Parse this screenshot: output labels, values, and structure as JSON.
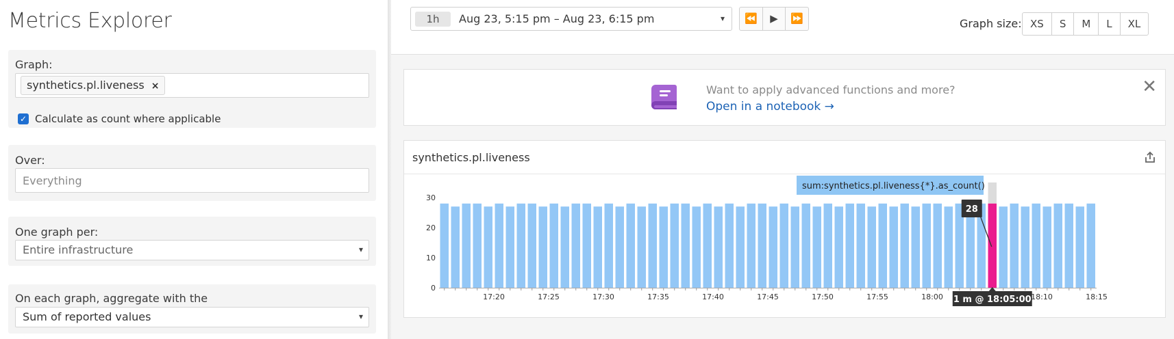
{
  "left": {
    "title": "Metrics Explorer",
    "graph": {
      "label": "Graph:",
      "metric": "synthetics.pl.liveness",
      "remove": "×",
      "checkbox_label": "Calculate as count where applicable",
      "checked": true
    },
    "over": {
      "label": "Over:",
      "placeholder": "Everything"
    },
    "per": {
      "label": "One graph per:",
      "value": "Entire infrastructure"
    },
    "agg": {
      "label": "On each graph, aggregate with the",
      "value": "Sum of reported values"
    },
    "dropdown_arrow": "▾"
  },
  "topbar": {
    "time_badge": "1h",
    "time_range": "Aug 23, 5:15 pm – Aug 23, 6:15 pm",
    "nav": [
      "⏪",
      "▶",
      "⏩"
    ],
    "graph_size_label": "Graph size:",
    "sizes": [
      "XS",
      "S",
      "M",
      "L",
      "XL"
    ]
  },
  "banner": {
    "text": "Want to apply advanced functions and more?",
    "link": "Open in a notebook →",
    "close": "✕",
    "icon": "notebook-icon",
    "icon_color": "#a564d3"
  },
  "graph": {
    "title": "synthetics.pl.liveness",
    "share_icon": "share-icon"
  },
  "chart_data": {
    "type": "bar",
    "series": [
      {
        "name": "sum:synthetics.pl.liveness{*}.as_count()",
        "values": [
          28,
          27,
          28,
          28,
          27,
          28,
          27,
          28,
          28,
          27,
          28,
          27,
          28,
          28,
          27,
          28,
          27,
          28,
          27,
          28,
          27,
          28,
          28,
          27,
          28,
          27,
          28,
          27,
          28,
          28,
          27,
          28,
          27,
          28,
          27,
          28,
          27,
          28,
          28,
          27,
          28,
          27,
          28,
          27,
          28,
          28,
          27,
          28,
          27,
          28,
          28,
          27,
          28,
          27,
          28,
          27,
          28,
          28,
          27,
          28
        ],
        "color": "#93c7f6"
      }
    ],
    "highlight_index": 50,
    "highlight_color": "#ea1c8e",
    "highlight_max": 35,
    "ylim": [
      0,
      30
    ],
    "yticks": [
      0,
      10,
      20,
      30
    ],
    "xtick_labels": [
      "17:20",
      "17:25",
      "17:30",
      "17:35",
      "17:40",
      "17:45",
      "17:50",
      "17:55",
      "18:00",
      "18:05",
      "18:10",
      "18:15"
    ],
    "tooltip": {
      "series": "sum:synthetics.pl.liveness{*}.as_count()",
      "value": "28",
      "time": "1 m @ 18:05:00"
    }
  }
}
